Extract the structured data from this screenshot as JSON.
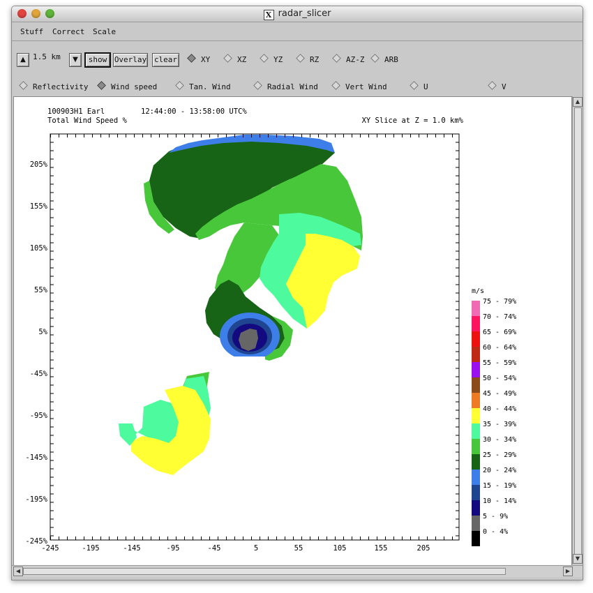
{
  "window": {
    "title": "radar_slicer"
  },
  "menu": [
    "Stuff",
    "Correct",
    "Scale"
  ],
  "toolbar": {
    "height_value": "1.5 km",
    "show_label": "show",
    "overlay_label": "Overlay",
    "clear_label": "clear",
    "slice_modes": [
      {
        "label": "XY",
        "selected": true
      },
      {
        "label": "XZ",
        "selected": false
      },
      {
        "label": "YZ",
        "selected": false
      },
      {
        "label": "RZ",
        "selected": false
      },
      {
        "label": "AZ-Z",
        "selected": false
      },
      {
        "label": "ARB",
        "selected": false
      }
    ],
    "fields": [
      {
        "label": "Reflectivity",
        "selected": false
      },
      {
        "label": "Wind speed",
        "selected": true
      },
      {
        "label": "Tan. Wind",
        "selected": false
      },
      {
        "label": "Radial Wind",
        "selected": false
      },
      {
        "label": "Vert Wind",
        "selected": false
      },
      {
        "label": "U",
        "selected": false
      },
      {
        "label": "V",
        "selected": false
      }
    ]
  },
  "plot": {
    "header_left_1": "100903H1 Earl",
    "header_time": "12:44:00 - 13:58:00 UTC%",
    "header_left_2": "Total Wind Speed %",
    "header_right": "XY Slice at Z = 1.0 km%",
    "x_ticks": [
      "-245",
      "-195",
      "-145",
      "-95",
      "-45",
      "5",
      "55",
      "105",
      "155",
      "205"
    ],
    "y_ticks": [
      "205%",
      "155%",
      "105%",
      "55%",
      "5%",
      "-45%",
      "-95%",
      "-145%",
      "-195%",
      "-245%"
    ]
  },
  "legend": {
    "unit": "m/s",
    "items": [
      {
        "label": "75 - 79%",
        "color": "#f06ab4"
      },
      {
        "label": "70 - 74%",
        "color": "#ff1460"
      },
      {
        "label": "65 - 69%",
        "color": "#ee1111"
      },
      {
        "label": "60 - 64%",
        "color": "#c02a14"
      },
      {
        "label": "55 - 59%",
        "color": "#9a10ee"
      },
      {
        "label": "50 - 54%",
        "color": "#8b4c1a"
      },
      {
        "label": "45 - 49%",
        "color": "#ee7a22"
      },
      {
        "label": "40 - 44%",
        "color": "#ffff33"
      },
      {
        "label": "35 - 39%",
        "color": "#4dfa9d"
      },
      {
        "label": "30 - 34%",
        "color": "#49c73a"
      },
      {
        "label": "25 - 29%",
        "color": "#176416"
      },
      {
        "label": "20 - 24%",
        "color": "#3e7ee8"
      },
      {
        "label": "15 - 19%",
        "color": "#1f4590"
      },
      {
        "label": "10 - 14%",
        "color": "#120a7e"
      },
      {
        "label": "5 - 9%",
        "color": "#666666"
      },
      {
        "label": "0 - 4%",
        "color": "#000000"
      }
    ]
  }
}
